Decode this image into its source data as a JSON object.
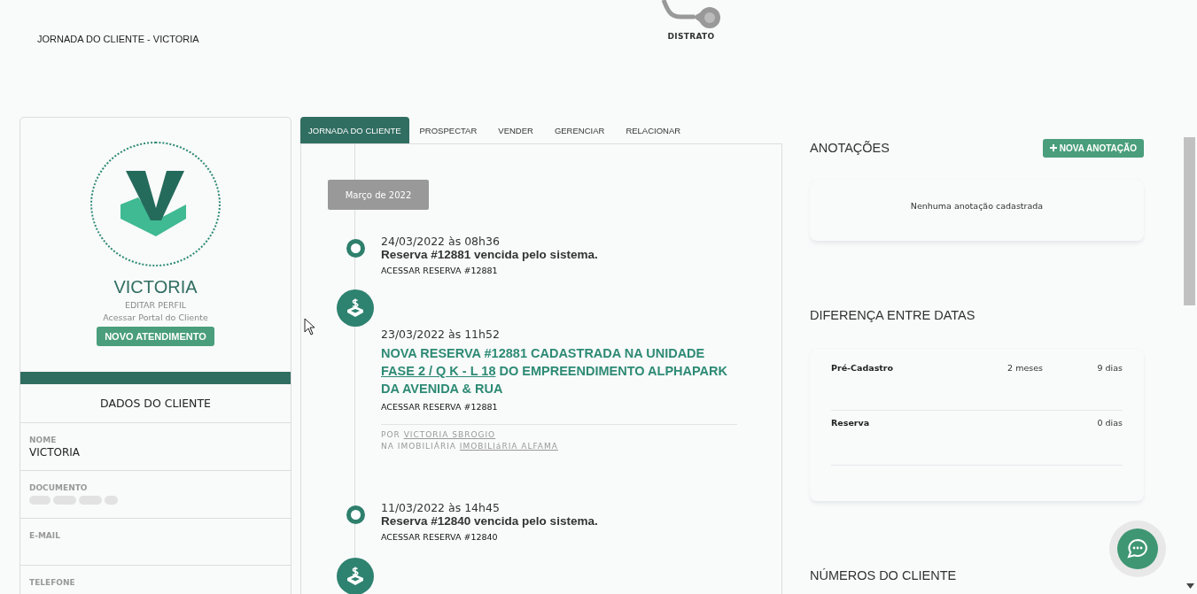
{
  "header": {
    "title": "JORNADA DO CLIENTE - VICTORIA",
    "stage": {
      "label": "DISTRATO"
    }
  },
  "profile": {
    "name": "VICTORIA",
    "edit_link": "EDITAR PERFIL",
    "portal_link": "Acessar Portal do Cliente",
    "button": "NOVO ATENDIMENTO",
    "section_title": "DADOS DO CLIENTE",
    "fields": [
      {
        "label": "NOME",
        "value": "VICTORIA",
        "redacted": false
      },
      {
        "label": "DOCUMENTO",
        "redacted": true
      },
      {
        "label": "E-MAIL",
        "redacted": false
      },
      {
        "label": "TELEFONE",
        "redacted": false
      }
    ]
  },
  "tabs": [
    {
      "label": "JORNADA DO CLIENTE",
      "selected": true
    },
    {
      "label": "PROSPECTAR",
      "selected": false
    },
    {
      "label": "VENDER",
      "selected": false
    },
    {
      "label": "GERENCIAR",
      "selected": false
    },
    {
      "label": "RELACIONAR",
      "selected": false
    }
  ],
  "timeline": {
    "month": "Março de 2022",
    "events": [
      {
        "kind": "expired",
        "date": "24/03/2022 às 08h36",
        "title_parts": [
          {
            "text": "Reserva #12881 vencida pelo sistema.",
            "link": false
          }
        ],
        "action": "ACESSAR RESERVA #12881"
      },
      {
        "kind": "reservation",
        "date": "23/03/2022 às 11h52",
        "title_parts": [
          {
            "text": "NOVA RESERVA #12881 CADASTRADA NA UNIDADE ",
            "link": false
          },
          {
            "text": "FASE 2 / Q K - L 18",
            "link": true
          },
          {
            "text": " DO EMPREENDIMENTO ALPHAPARK DA AVENIDA & RUA",
            "link": false
          }
        ],
        "action": "ACESSAR RESERVA #12881",
        "by_label": "POR",
        "by": "VICTORIA SBROGIO",
        "agency_label": "NA IMOBILIÁRIA",
        "agency": "IMOBILIáRIA ALFAMA"
      },
      {
        "kind": "expired",
        "date": "11/03/2022 às 14h45",
        "title_parts": [
          {
            "text": "Reserva #12840 vencida pelo sistema.",
            "link": false
          }
        ],
        "action": "ACESSAR RESERVA #12840"
      },
      {
        "kind": "reservation"
      }
    ]
  },
  "notes": {
    "title": "ANOTAÇÕES",
    "button": "NOVA ANOTAÇÃO",
    "empty": "Nenhuma anotação cadastrada"
  },
  "date_diff": {
    "title": "DIFERENÇA ENTRE DATAS",
    "rows": [
      {
        "label": "Pré-Cadastro",
        "value_1": "2 meses",
        "value_2": "9 dias"
      },
      {
        "label": "Reserva",
        "value_2": "0 dias"
      }
    ]
  },
  "client_numbers": {
    "title": "NÚMEROS DO CLIENTE"
  }
}
